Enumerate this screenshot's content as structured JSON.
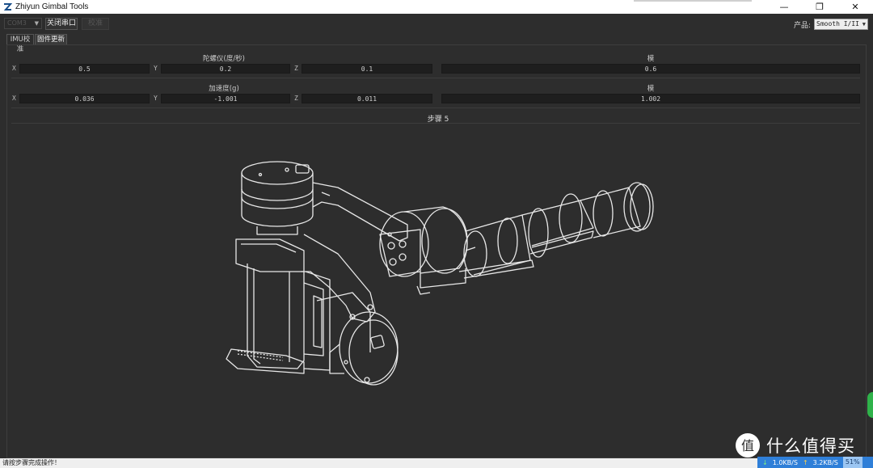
{
  "window": {
    "title": "Zhiyun Gimbal Tools",
    "controls": {
      "minimize": "—",
      "maximize": "❐",
      "close": "✕"
    }
  },
  "toolbar": {
    "port_select_value": "COM3",
    "close_port_label": "关闭串口",
    "calibrate_label": "校准",
    "product_label": "产品:",
    "product_value": "Smooth I/II"
  },
  "tabs": [
    {
      "label": "IMU校准",
      "active": false
    },
    {
      "label": "固件更新",
      "active": true
    }
  ],
  "gyro": {
    "title": "陀螺仪(度/秒)",
    "x_label": "X",
    "x": "0.5",
    "y_label": "Y",
    "y": "0.2",
    "z_label": "Z",
    "z": "0.1",
    "mag_title": "模",
    "mag": "0.6"
  },
  "accel": {
    "title": "加速度(g)",
    "x_label": "X",
    "x": "0.036",
    "y_label": "Y",
    "y": "-1.001",
    "z_label": "Z",
    "z": "0.011",
    "mag_title": "模",
    "mag": "1.002"
  },
  "step_label": "步骤 5",
  "status": {
    "message": "请按步骤完成操作！"
  },
  "taskbar": {
    "download": "1.0KB/S",
    "upload": "3.2KB/S",
    "percent": "51%"
  },
  "watermark": {
    "text": "什么值得买",
    "logo_char": "值"
  },
  "icons": {
    "app": "zhiyun-logo-icon",
    "down": "arrow-down-icon",
    "up": "arrow-up-icon"
  }
}
